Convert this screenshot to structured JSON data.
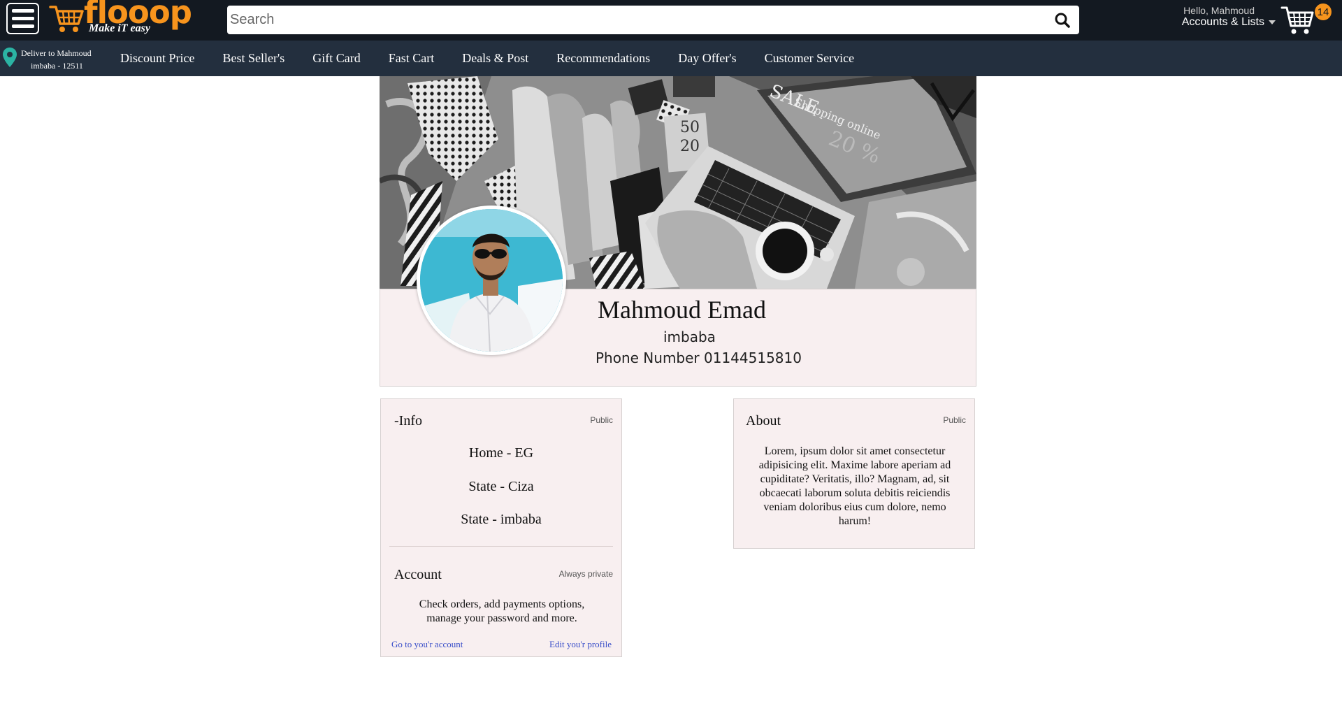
{
  "header": {
    "logo_text": "flooop",
    "logo_tagline": "Make iT easy",
    "search_placeholder": "Search",
    "greeting": "Hello, Mahmoud",
    "account_label": "Accounts & Lists",
    "cart_count": "14",
    "icons": [
      "menu-icon",
      "cart-logo-icon",
      "search-icon",
      "caret-down-icon",
      "cart-icon"
    ]
  },
  "nav": {
    "deliver_line1": "Deliver to Mahmoud",
    "deliver_line2": "imbaba - 12511",
    "items": [
      "Discount Price",
      "Best Seller's",
      "Gift Card",
      "Fast Cart",
      "Deals & Post",
      "Recommendations",
      "Day Offer's",
      "Customer Service"
    ]
  },
  "profile": {
    "name": "Mahmoud Emad",
    "city": "imbaba",
    "phone": "Phone Number 01144515810"
  },
  "info_card": {
    "title": "-Info",
    "visibility": "Public",
    "lines": [
      "Home - EG",
      "State - Ciza",
      "State - imbaba"
    ]
  },
  "account_card": {
    "title": "Account",
    "visibility": "Always private",
    "text": "Check orders, add payments options, manage your password and more.",
    "link_account": "Go to you'r account",
    "link_edit": "Edit you'r profile"
  },
  "about_card": {
    "title": "About",
    "visibility": "Public",
    "text": "Lorem, ipsum dolor sit amet consectetur adipisicing elit. Maxime labore aperiam ad cupiditate? Veritatis, illo? Magnam, ad, sit obcaecati laborum soluta debitis reiciendis veniam doloribus eius cum dolore, nemo harum!"
  },
  "cover_image": {
    "overlay_sale": "SALE",
    "overlay_shopping": "Shopping online",
    "overlay_percent": "20 %",
    "tag_top": "50",
    "tag_bottom": "20"
  },
  "colors": {
    "header_bg": "#131921",
    "nav_bg": "#232f3e",
    "brand_orange": "#f7941d",
    "card_bg": "#f8eff0",
    "link_blue": "#3a4fc9",
    "location_pin": "#2bb3a3"
  }
}
